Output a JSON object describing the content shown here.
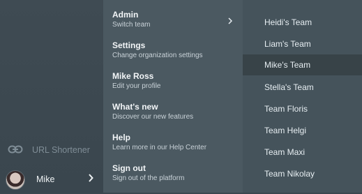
{
  "sidebar": {
    "url_shortener": {
      "label": "URL Shortener",
      "icon": "link-icon"
    },
    "user": {
      "name": "Mike",
      "chevron_icon": "chevron-right-icon"
    }
  },
  "menu": {
    "items": [
      {
        "title": "Admin",
        "subtitle": "Switch team",
        "has_submenu": true
      },
      {
        "title": "Settings",
        "subtitle": "Change organization settings"
      },
      {
        "title": "Mike Ross",
        "subtitle": "Edit your profile"
      },
      {
        "title": "What's new",
        "subtitle": "Discover our new features"
      },
      {
        "title": "Help",
        "subtitle": "Learn more in our Help Center"
      },
      {
        "title": "Sign out",
        "subtitle": "Sign out of the platform"
      }
    ]
  },
  "teams": {
    "items": [
      {
        "name": "Heidi's Team"
      },
      {
        "name": "Liam's Team"
      },
      {
        "name": "Mike's Team",
        "selected": true
      },
      {
        "name": "Stella's Team"
      },
      {
        "name": "Team Floris"
      },
      {
        "name": "Team Helgi"
      },
      {
        "name": "Team Maxi"
      },
      {
        "name": "Team Nikolay"
      }
    ]
  },
  "colors": {
    "sidebar_bg": "#3f4b53",
    "menu_bg": "#4b5961",
    "teams_bg": "#45535b",
    "selected_team_bg": "#384348"
  }
}
